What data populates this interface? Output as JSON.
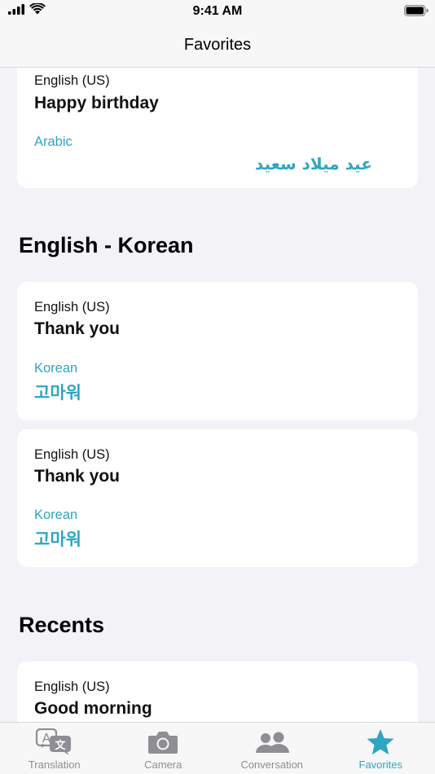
{
  "status_bar": {
    "time": "9:41 AM"
  },
  "nav": {
    "title": "Favorites"
  },
  "cards": [
    {
      "source_language": "English (US)",
      "source_text": "Happy birthday",
      "target_language": "Arabic",
      "target_text": "عيد ميلاد سعيد"
    },
    {
      "source_language": "English (US)",
      "source_text": "Thank you",
      "target_language": "Korean",
      "target_text": "고마워"
    },
    {
      "source_language": "English (US)",
      "source_text": "Thank you",
      "target_language": "Korean",
      "target_text": "고마워"
    },
    {
      "source_language": "English (US)",
      "source_text": "Good morning"
    }
  ],
  "sections": [
    {
      "title": "English - Korean"
    },
    {
      "title": "Recents"
    }
  ],
  "tabs": [
    {
      "label": "Translation",
      "icon": "translation-icon",
      "active": false
    },
    {
      "label": "Camera",
      "icon": "camera-icon",
      "active": false
    },
    {
      "label": "Conversation",
      "icon": "conversation-icon",
      "active": false
    },
    {
      "label": "Favorites",
      "icon": "star-icon",
      "active": true
    }
  ],
  "colors": {
    "accent": "#2fa5c4",
    "inactive": "#8e8e93",
    "background": "#f2f2f7"
  }
}
